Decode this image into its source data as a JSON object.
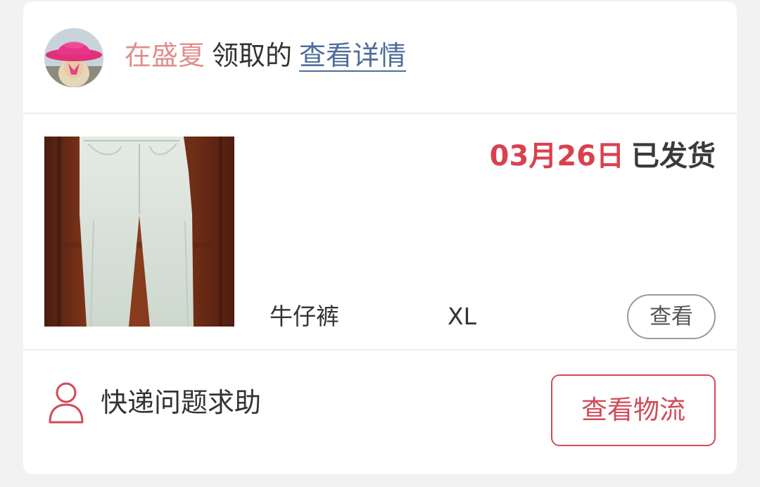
{
  "header": {
    "receiver_name": "在盛夏",
    "received_label": "领取的",
    "detail_link": "查看详情"
  },
  "product": {
    "ship_date": "03月26日",
    "ship_status": "已发货",
    "name": "牛仔裤",
    "size": "XL",
    "view_label": "查看"
  },
  "footer": {
    "help_label": "快递问题求助",
    "logistics_label": "查看物流"
  },
  "icons": {
    "avatar": "user-avatar",
    "help": "person-icon"
  },
  "colors": {
    "accent": "#d24b58",
    "ship_date": "#d9414f",
    "receiver_name": "#e08e8e",
    "link": "#4f6d9a"
  }
}
